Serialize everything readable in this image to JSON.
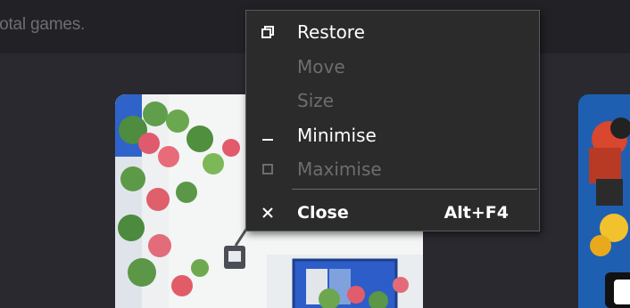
{
  "header": {
    "games_count_text": "total games."
  },
  "context_menu": {
    "items": [
      {
        "label": "Restore",
        "enabled": true,
        "icon": "restore-icon"
      },
      {
        "label": "Move",
        "enabled": false,
        "icon": ""
      },
      {
        "label": "Size",
        "enabled": false,
        "icon": ""
      },
      {
        "label": "Minimise",
        "enabled": true,
        "icon": "minimise-icon"
      },
      {
        "label": "Maximise",
        "enabled": false,
        "icon": "maximise-icon"
      },
      {
        "label": "Close",
        "enabled": true,
        "icon": "close-icon",
        "shortcut": "Alt+F4"
      }
    ]
  },
  "colors": {
    "background": "#2a2930",
    "topbar": "#222126",
    "menu_bg": "#2b2b2b",
    "menu_border": "#5a5a5a",
    "text_enabled": "#ffffff",
    "text_disabled": "#6d6d6d"
  }
}
